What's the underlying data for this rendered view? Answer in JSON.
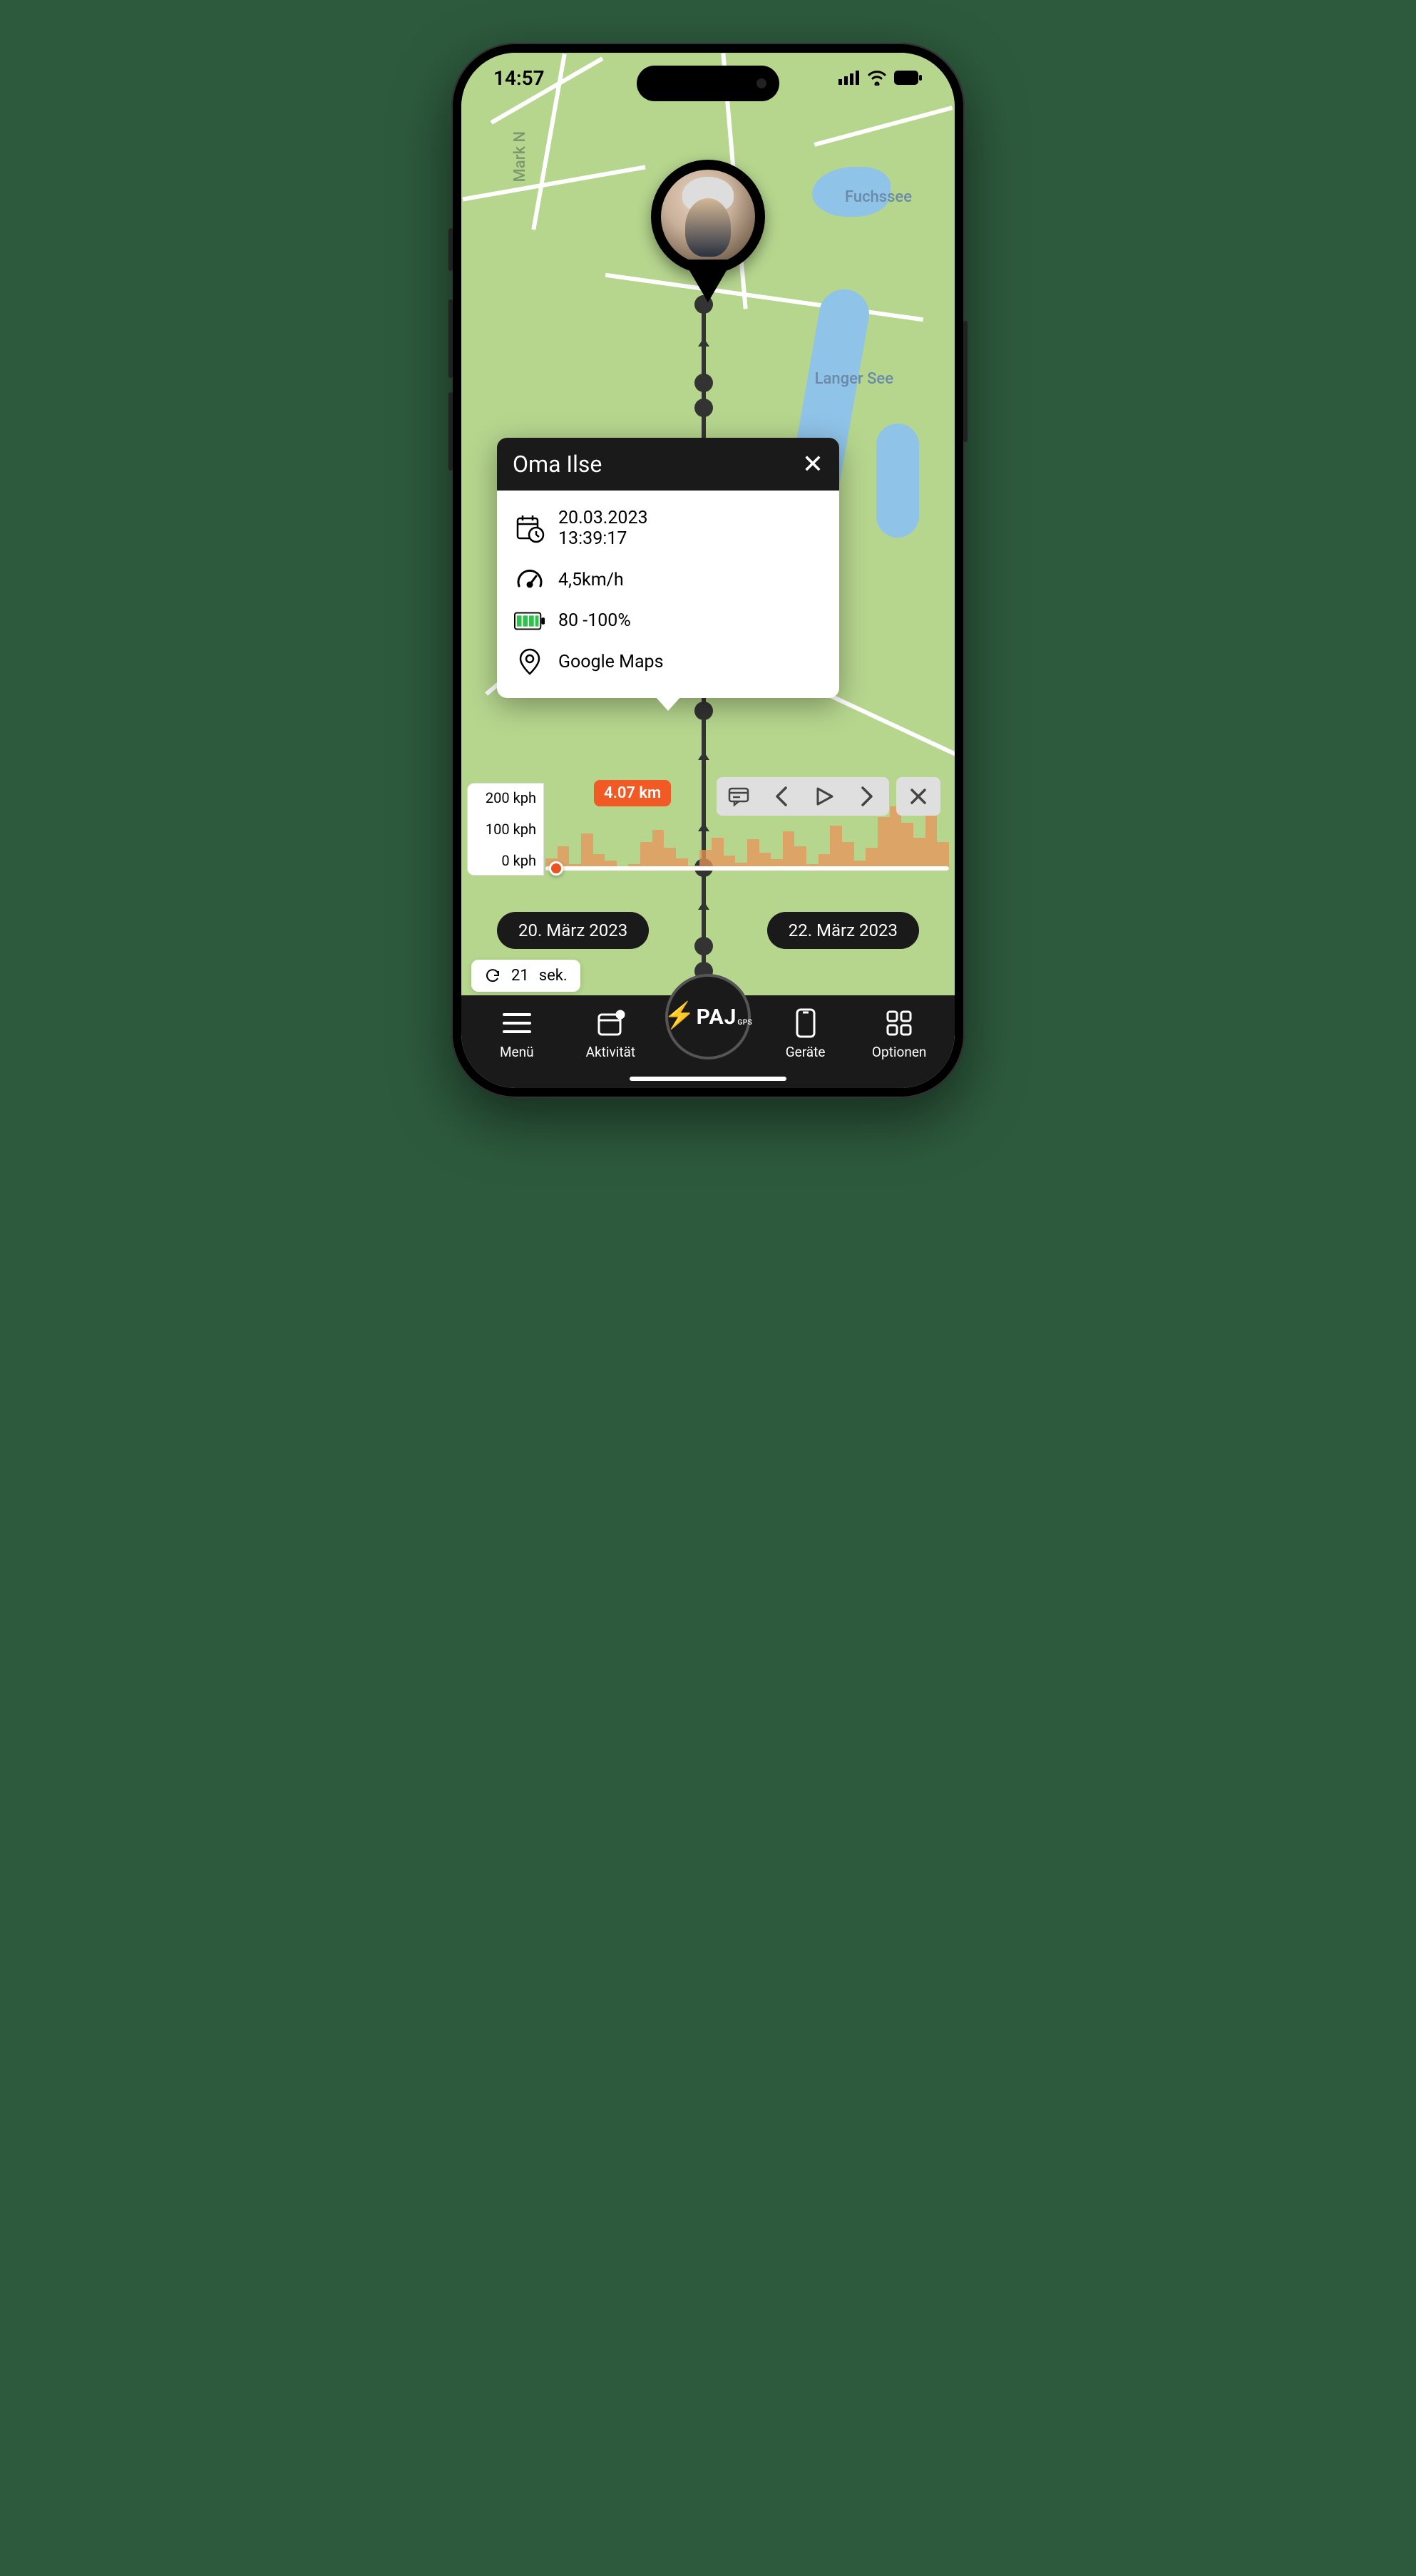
{
  "status": {
    "time": "14:57"
  },
  "map": {
    "labels": {
      "fuchssee": "Fuchssee",
      "langer_see": "Langer See",
      "mark": "Mark N"
    }
  },
  "card": {
    "title": "Oma Ilse",
    "date": "20.03.2023",
    "time": "13:39:17",
    "speed": "4,5km/h",
    "battery": "80 -100%",
    "maps": "Google Maps"
  },
  "speed_panel": {
    "y_200": "200 kph",
    "y_100": "100 kph",
    "y_0": "0 kph",
    "distance": "4.07 km"
  },
  "dates": {
    "start": "20. März 2023",
    "end": "22. März 2023"
  },
  "refresh": {
    "value": "21",
    "unit": "sek."
  },
  "nav": {
    "menu": "Menü",
    "activity": "Aktivität",
    "devices": "Geräte",
    "options": "Optionen",
    "brand": "PAJ",
    "brand_sub": "GPS"
  }
}
